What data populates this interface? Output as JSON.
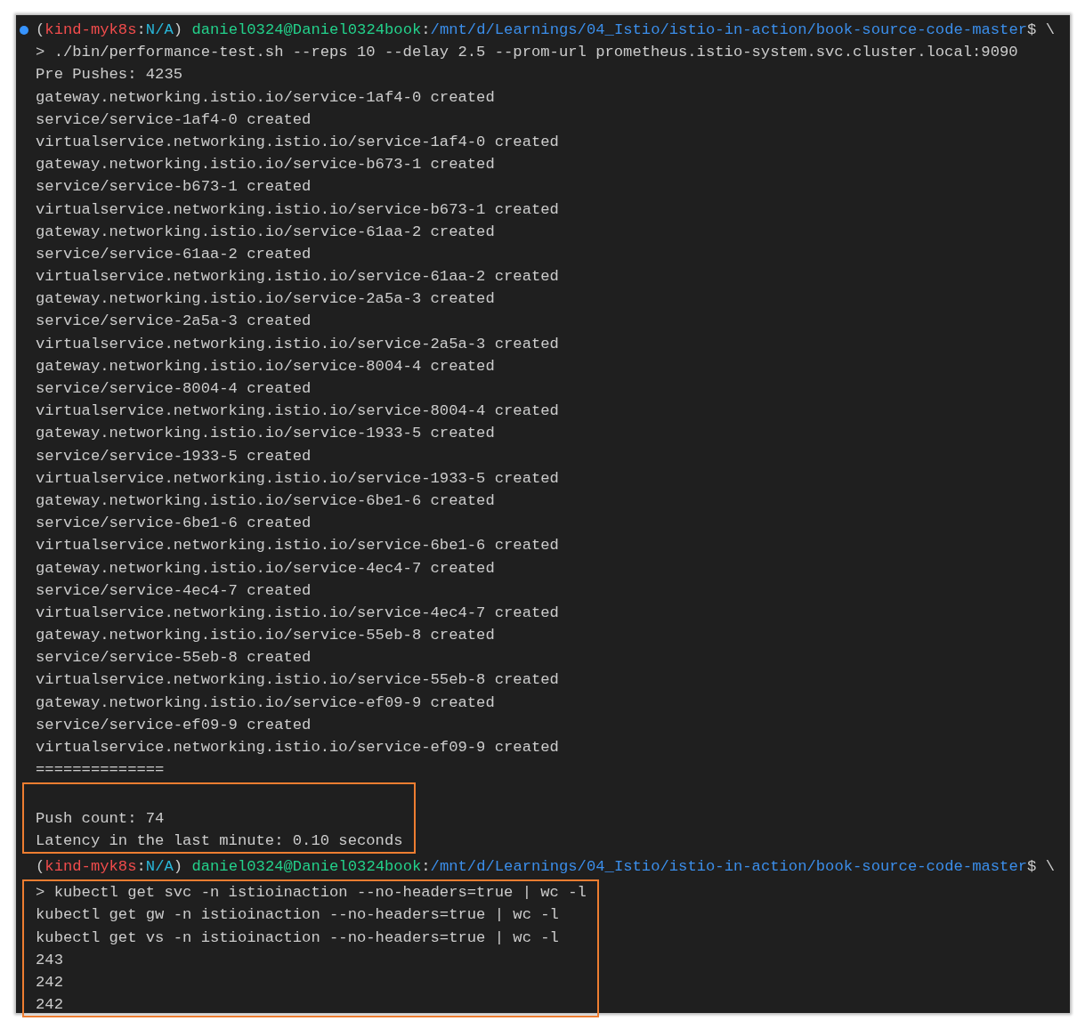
{
  "terminal": {
    "sections": [
      {
        "highlighted": false,
        "lines": [
          {
            "kind": "prompt",
            "status_dot": true,
            "segments": [
              {
                "kind": "plain",
                "text": "("
              },
              {
                "kind": "context",
                "text": "kind-myk8s"
              },
              {
                "kind": "plain",
                "text": ":"
              },
              {
                "kind": "namespace",
                "text": "N/A"
              },
              {
                "kind": "plain",
                "text": ") "
              },
              {
                "kind": "user",
                "text": "daniel0324@Daniel0324book"
              },
              {
                "kind": "plain",
                "text": ":"
              },
              {
                "kind": "path",
                "text": "/mnt/d/Learnings/04_Istio/istio-in-action/book-source-code-master"
              },
              {
                "kind": "plain",
                "text": "$ \\"
              }
            ]
          },
          {
            "kind": "command",
            "text": "> ./bin/performance-test.sh --reps 10 --delay 2.5 --prom-url prometheus.istio-system.svc.cluster.local:9090"
          },
          {
            "kind": "output",
            "text": "Pre Pushes: 4235"
          },
          {
            "kind": "output",
            "text": "gateway.networking.istio.io/service-1af4-0 created"
          },
          {
            "kind": "output",
            "text": "service/service-1af4-0 created"
          },
          {
            "kind": "output",
            "text": "virtualservice.networking.istio.io/service-1af4-0 created"
          },
          {
            "kind": "output",
            "text": "gateway.networking.istio.io/service-b673-1 created"
          },
          {
            "kind": "output",
            "text": "service/service-b673-1 created"
          },
          {
            "kind": "output",
            "text": "virtualservice.networking.istio.io/service-b673-1 created"
          },
          {
            "kind": "output",
            "text": "gateway.networking.istio.io/service-61aa-2 created"
          },
          {
            "kind": "output",
            "text": "service/service-61aa-2 created"
          },
          {
            "kind": "output",
            "text": "virtualservice.networking.istio.io/service-61aa-2 created"
          },
          {
            "kind": "output",
            "text": "gateway.networking.istio.io/service-2a5a-3 created"
          },
          {
            "kind": "output",
            "text": "service/service-2a5a-3 created"
          },
          {
            "kind": "output",
            "text": "virtualservice.networking.istio.io/service-2a5a-3 created"
          },
          {
            "kind": "output",
            "text": "gateway.networking.istio.io/service-8004-4 created"
          },
          {
            "kind": "output",
            "text": "service/service-8004-4 created"
          },
          {
            "kind": "output",
            "text": "virtualservice.networking.istio.io/service-8004-4 created"
          },
          {
            "kind": "output",
            "text": "gateway.networking.istio.io/service-1933-5 created"
          },
          {
            "kind": "output",
            "text": "service/service-1933-5 created"
          },
          {
            "kind": "output",
            "text": "virtualservice.networking.istio.io/service-1933-5 created"
          },
          {
            "kind": "output",
            "text": "gateway.networking.istio.io/service-6be1-6 created"
          },
          {
            "kind": "output",
            "text": "service/service-6be1-6 created"
          },
          {
            "kind": "output",
            "text": "virtualservice.networking.istio.io/service-6be1-6 created"
          },
          {
            "kind": "output",
            "text": "gateway.networking.istio.io/service-4ec4-7 created"
          },
          {
            "kind": "output",
            "text": "service/service-4ec4-7 created"
          },
          {
            "kind": "output",
            "text": "virtualservice.networking.istio.io/service-4ec4-7 created"
          },
          {
            "kind": "output",
            "text": "gateway.networking.istio.io/service-55eb-8 created"
          },
          {
            "kind": "output",
            "text": "service/service-55eb-8 created"
          },
          {
            "kind": "output",
            "text": "virtualservice.networking.istio.io/service-55eb-8 created"
          },
          {
            "kind": "output",
            "text": "gateway.networking.istio.io/service-ef09-9 created"
          },
          {
            "kind": "output",
            "text": "service/service-ef09-9 created"
          },
          {
            "kind": "output",
            "text": "virtualservice.networking.istio.io/service-ef09-9 created"
          },
          {
            "kind": "output",
            "text": "=============="
          }
        ]
      },
      {
        "highlighted": true,
        "lines": [
          {
            "kind": "blank"
          },
          {
            "kind": "output",
            "text": "Push count: 74"
          },
          {
            "kind": "output",
            "text": "Latency in the last minute: 0.10 seconds"
          }
        ]
      },
      {
        "highlighted": false,
        "lines": [
          {
            "kind": "prompt",
            "status_dot": false,
            "segments": [
              {
                "kind": "plain",
                "text": "("
              },
              {
                "kind": "context",
                "text": "kind-myk8s"
              },
              {
                "kind": "plain",
                "text": ":"
              },
              {
                "kind": "namespace",
                "text": "N/A"
              },
              {
                "kind": "plain",
                "text": ") "
              },
              {
                "kind": "user",
                "text": "daniel0324@Daniel0324book"
              },
              {
                "kind": "plain",
                "text": ":"
              },
              {
                "kind": "path",
                "text": "/mnt/d/Learnings/04_Istio/istio-in-action/book-source-code-master"
              },
              {
                "kind": "plain",
                "text": "$ \\"
              }
            ]
          }
        ]
      },
      {
        "highlighted": true,
        "lines": [
          {
            "kind": "command",
            "text": "> kubectl get svc -n istioinaction --no-headers=true | wc -l"
          },
          {
            "kind": "output",
            "text": "kubectl get gw -n istioinaction --no-headers=true | wc -l"
          },
          {
            "kind": "output",
            "text": "kubectl get vs -n istioinaction --no-headers=true | wc -l"
          },
          {
            "kind": "output",
            "text": "243"
          },
          {
            "kind": "output",
            "text": "242"
          },
          {
            "kind": "output",
            "text": "242"
          }
        ]
      }
    ]
  }
}
